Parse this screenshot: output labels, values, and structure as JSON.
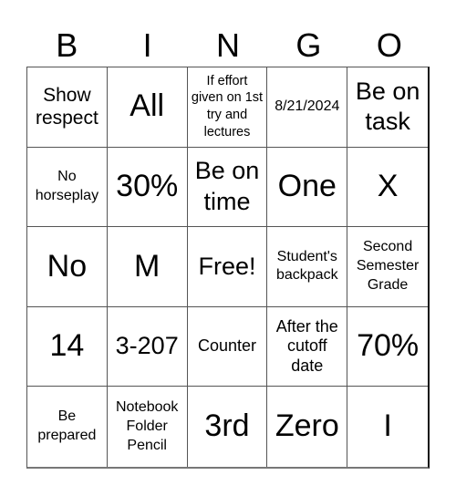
{
  "card": {
    "header": [
      "B",
      "I",
      "N",
      "G",
      "O"
    ],
    "rows": [
      [
        {
          "text": "Show respect",
          "size": "s-m"
        },
        {
          "text": "All",
          "size": "s-xl"
        },
        {
          "text": "If effort given on 1st try and lectures",
          "size": "s-xs"
        },
        {
          "text": "8/21/2024",
          "size": "s-s"
        },
        {
          "text": "Be on task",
          "size": "s-l"
        }
      ],
      [
        {
          "text": "No horseplay",
          "size": "s-s"
        },
        {
          "text": "30%",
          "size": "s-xl"
        },
        {
          "text": "Be on time",
          "size": "s-l"
        },
        {
          "text": "One",
          "size": "s-xl"
        },
        {
          "text": "X",
          "size": "s-xl"
        }
      ],
      [
        {
          "text": "No",
          "size": "s-xl"
        },
        {
          "text": "M",
          "size": "s-xl"
        },
        {
          "text": "Free!",
          "size": "s-l"
        },
        {
          "text": "Student's backpack",
          "size": "s-s"
        },
        {
          "text": "Second Semester Grade",
          "size": "s-s"
        }
      ],
      [
        {
          "text": "14",
          "size": "s-xl"
        },
        {
          "text": "3-207",
          "size": "s-l"
        },
        {
          "text": "Counter",
          "size": "s-sm"
        },
        {
          "text": "After the cutoff date",
          "size": "s-sm"
        },
        {
          "text": "70%",
          "size": "s-xl"
        }
      ],
      [
        {
          "text": "Be prepared",
          "size": "s-s"
        },
        {
          "text": "Notebook Folder Pencil",
          "size": "s-s"
        },
        {
          "text": "3rd",
          "size": "s-xl"
        },
        {
          "text": "Zero",
          "size": "s-xl"
        },
        {
          "text": "I",
          "size": "s-xl"
        }
      ]
    ]
  }
}
